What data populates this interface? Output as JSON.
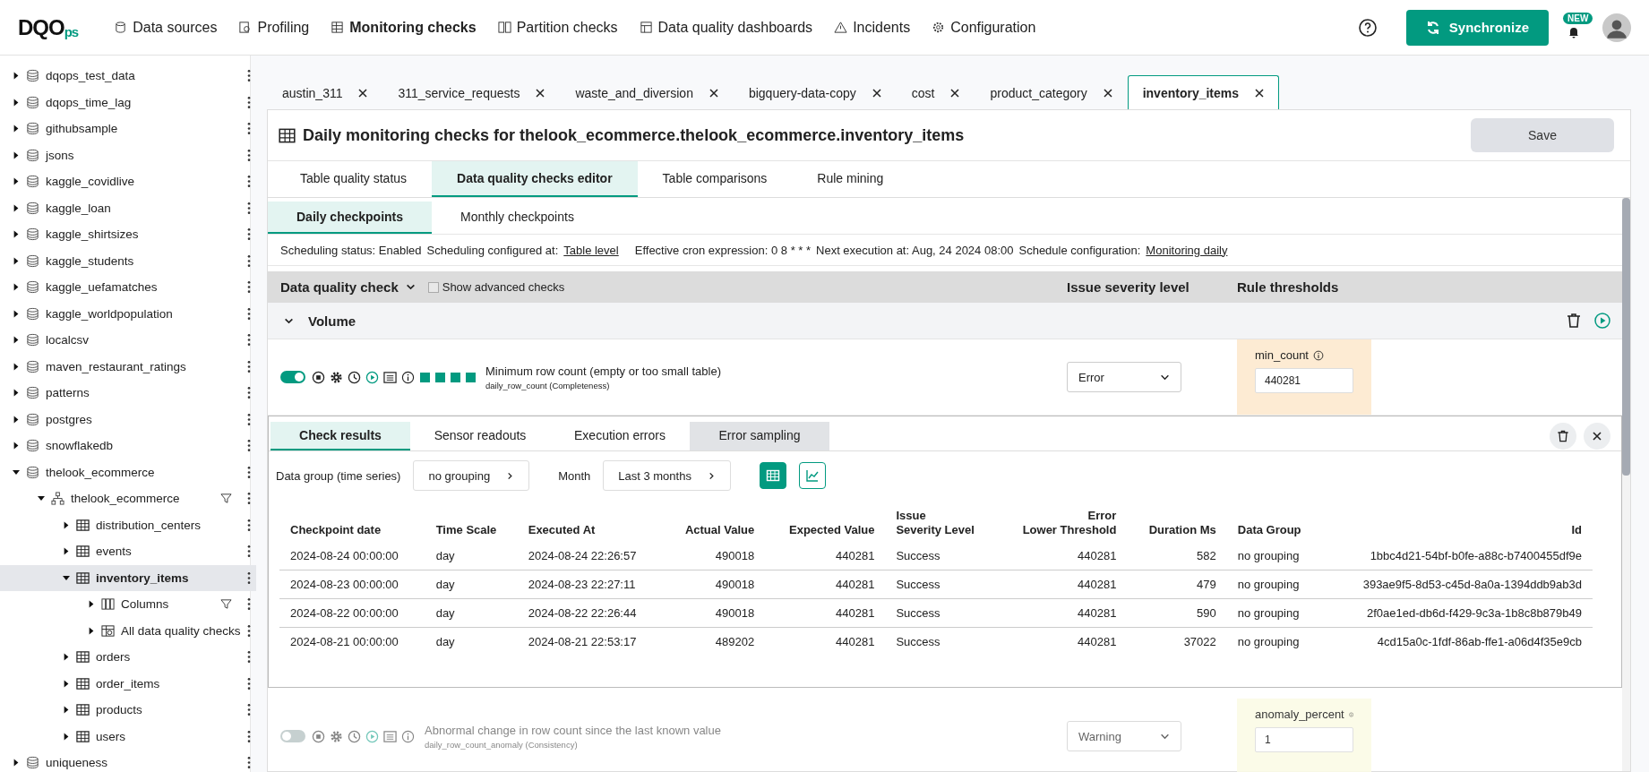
{
  "logo": "DQO$_{ps}$",
  "nav": {
    "items": [
      {
        "label": "Data sources",
        "selected": false
      },
      {
        "label": "Profiling",
        "selected": false
      },
      {
        "label": "Monitoring checks",
        "selected": true
      },
      {
        "label": "Partition checks",
        "selected": false
      },
      {
        "label": "Data quality dashboards",
        "selected": false
      },
      {
        "label": "Incidents",
        "selected": false
      },
      {
        "label": "Configuration",
        "selected": false
      }
    ],
    "sync_button": "Synchronize",
    "new_badge": "NEW"
  },
  "sidebar": {
    "items": [
      {
        "label": "dqops_test_data",
        "kind": "connection",
        "expanded": false,
        "selected": false
      },
      {
        "label": "dqops_time_lag",
        "kind": "connection",
        "expanded": false,
        "selected": false
      },
      {
        "label": "githubsample",
        "kind": "connection",
        "expanded": false,
        "selected": false
      },
      {
        "label": "jsons",
        "kind": "connection",
        "expanded": false,
        "selected": false
      },
      {
        "label": "kaggle_covidlive",
        "kind": "connection",
        "expanded": false,
        "selected": false
      },
      {
        "label": "kaggle_loan",
        "kind": "connection",
        "expanded": false,
        "selected": false
      },
      {
        "label": "kaggle_shirtsizes",
        "kind": "connection",
        "expanded": false,
        "selected": false
      },
      {
        "label": "kaggle_students",
        "kind": "connection",
        "expanded": false,
        "selected": false
      },
      {
        "label": "kaggle_uefamatches",
        "kind": "connection",
        "expanded": false,
        "selected": false
      },
      {
        "label": "kaggle_worldpopulation",
        "kind": "connection",
        "expanded": false,
        "selected": false
      },
      {
        "label": "localcsv",
        "kind": "connection",
        "expanded": false,
        "selected": false
      },
      {
        "label": "maven_restaurant_ratings",
        "kind": "connection",
        "expanded": false,
        "selected": false
      },
      {
        "label": "patterns",
        "kind": "connection",
        "expanded": false,
        "selected": false
      },
      {
        "label": "postgres",
        "kind": "connection",
        "expanded": false,
        "selected": false
      },
      {
        "label": "snowflakedb",
        "kind": "connection",
        "expanded": false,
        "selected": false
      },
      {
        "label": "thelook_ecommerce",
        "kind": "connection",
        "expanded": true,
        "selected": false,
        "children": [
          {
            "label": "thelook_ecommerce",
            "kind": "schema",
            "expanded": true,
            "selected": false,
            "filter": true,
            "children": [
              {
                "label": "distribution_centers",
                "kind": "table",
                "expanded": false,
                "selected": false
              },
              {
                "label": "events",
                "kind": "table",
                "expanded": false,
                "selected": false
              },
              {
                "label": "inventory_items",
                "kind": "table",
                "expanded": true,
                "selected": true,
                "children": [
                  {
                    "label": "Columns",
                    "kind": "columns",
                    "expanded": false,
                    "selected": false,
                    "filter": true
                  },
                  {
                    "label": "All data quality checks",
                    "kind": "checks",
                    "expanded": false,
                    "selected": false
                  }
                ]
              },
              {
                "label": "orders",
                "kind": "table",
                "expanded": false,
                "selected": false
              },
              {
                "label": "order_items",
                "kind": "table",
                "expanded": false,
                "selected": false
              },
              {
                "label": "products",
                "kind": "table",
                "expanded": false,
                "selected": false
              },
              {
                "label": "users",
                "kind": "table",
                "expanded": false,
                "selected": false
              }
            ]
          }
        ]
      },
      {
        "label": "uniqueness",
        "kind": "connection",
        "expanded": false,
        "selected": false
      }
    ]
  },
  "tabs": [
    {
      "label": "austin_311",
      "selected": false
    },
    {
      "label": "311_service_requests",
      "selected": false
    },
    {
      "label": "waste_and_diversion",
      "selected": false
    },
    {
      "label": "bigquery-data-copy",
      "selected": false
    },
    {
      "label": "cost",
      "selected": false
    },
    {
      "label": "product_category",
      "selected": false
    },
    {
      "label": "inventory_items",
      "selected": true
    }
  ],
  "title": "Daily monitoring checks for thelook_ecommerce.thelook_ecommerce.inventory_items",
  "save_button": "Save",
  "subtabs": [
    {
      "label": "Table quality status",
      "selected": false
    },
    {
      "label": "Data quality checks editor",
      "selected": true
    },
    {
      "label": "Table comparisons",
      "selected": false
    },
    {
      "label": "Rule mining",
      "selected": false
    }
  ],
  "checkpoint_tabs": [
    {
      "label": "Daily checkpoints",
      "selected": true
    },
    {
      "label": "Monthly checkpoints",
      "selected": false
    }
  ],
  "schedule": [
    {
      "text": "Scheduling status: Enabled"
    },
    {
      "text": "Scheduling configured at:",
      "link": "Table level"
    },
    {
      "text": "Effective cron expression: 0 8 * * *"
    },
    {
      "text": "Next execution at: Aug, 24 2024 08:00"
    },
    {
      "text": "Schedule configuration:",
      "link": "Monitoring daily"
    }
  ],
  "header": {
    "check": "Data quality check",
    "advanced": {
      "label": "Show advanced checks",
      "checked": false
    },
    "severity": "Issue severity level",
    "thresholds": "Rule thresholds"
  },
  "category": {
    "label": "Volume",
    "expanded": true
  },
  "checks": [
    {
      "enabled": true,
      "name": "Minimum row count (empty or too small table)",
      "sub": "daily_row_count (Completeness)",
      "severity": "Error",
      "param": "min_count",
      "value": "440281",
      "color": "#fdebd3",
      "results": [
        {
          "color": "#029a80"
        },
        {
          "color": "#029a80"
        },
        {
          "color": "#029a80"
        },
        {
          "color": "#029a80"
        }
      ]
    },
    {
      "enabled": false,
      "name": "Abnormal change in row count since the last known value",
      "sub": "daily_row_count_anomaly (Consistency)",
      "severity": "Warning",
      "param": "anomaly_percent",
      "value": "1",
      "color": "#fbfbe6"
    }
  ],
  "results": {
    "tabs": [
      {
        "label": "Check results",
        "selected": true,
        "kind": "plain"
      },
      {
        "label": "Sensor readouts",
        "selected": false,
        "kind": "plain"
      },
      {
        "label": "Execution errors",
        "selected": false,
        "kind": "plain"
      },
      {
        "label": "Error sampling",
        "selected": false,
        "kind": "shaded"
      }
    ],
    "group_label": "Data group (time series)",
    "group_value": "no grouping",
    "month_label": "Month",
    "month_value": "Last 3 months",
    "view_toggles": [
      {
        "selected": true
      },
      {
        "selected": false
      }
    ],
    "columns": [
      "Checkpoint date",
      "Time Scale",
      "Executed At",
      "Actual Value",
      "Expected Value",
      "Issue\nSeverity Level",
      "Error\nLower Threshold",
      "Duration Ms",
      "Data Group",
      "Id"
    ],
    "rows": [
      [
        "2024-08-24 00:00:00",
        "day",
        "2024-08-24 22:26:57",
        "490018",
        "440281",
        "Success",
        "440281",
        "582",
        "no grouping",
        "1bbc4d21-54bf-b0fe-a88c-b7400455df9e"
      ],
      [
        "2024-08-23 00:00:00",
        "day",
        "2024-08-23 22:27:11",
        "490018",
        "440281",
        "Success",
        "440281",
        "479",
        "no grouping",
        "393ae9f5-8d53-c45d-8a0a-1394ddb9ab3d"
      ],
      [
        "2024-08-22 00:00:00",
        "day",
        "2024-08-22 22:26:44",
        "490018",
        "440281",
        "Success",
        "440281",
        "590",
        "no grouping",
        "2f0ae1ed-db6d-f429-9c3a-1b8c8b879b49"
      ],
      [
        "2024-08-21 00:00:00",
        "day",
        "2024-08-21 22:53:17",
        "489202",
        "440281",
        "Success",
        "440281",
        "37022",
        "no grouping",
        "4cd15a0c-1fdf-86ab-ffe1-a06d4f35e9cb"
      ]
    ]
  }
}
